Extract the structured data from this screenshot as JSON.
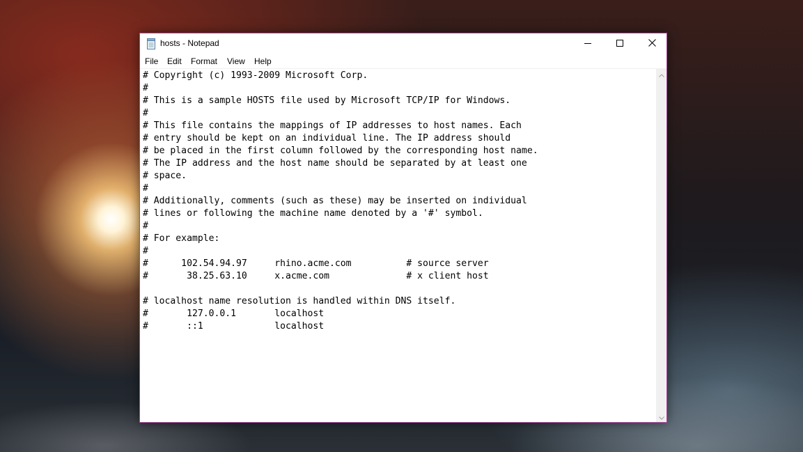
{
  "window": {
    "title": "hosts - Notepad",
    "accent_border": "#a7489a",
    "icon": "notepad-icon"
  },
  "caption_buttons": {
    "minimize": "minimize-icon",
    "maximize": "maximize-icon",
    "close": "close-icon"
  },
  "menu": {
    "file": "File",
    "edit": "Edit",
    "format": "Format",
    "view": "View",
    "help": "Help"
  },
  "editor": {
    "content": "# Copyright (c) 1993-2009 Microsoft Corp.\n#\n# This is a sample HOSTS file used by Microsoft TCP/IP for Windows.\n#\n# This file contains the mappings of IP addresses to host names. Each\n# entry should be kept on an individual line. The IP address should\n# be placed in the first column followed by the corresponding host name.\n# The IP address and the host name should be separated by at least one\n# space.\n#\n# Additionally, comments (such as these) may be inserted on individual\n# lines or following the machine name denoted by a '#' symbol.\n#\n# For example:\n#\n#      102.54.94.97     rhino.acme.com          # source server\n#       38.25.63.10     x.acme.com              # x client host\n\n# localhost name resolution is handled within DNS itself.\n#\t127.0.0.1       localhost\n#\t::1             localhost"
  }
}
